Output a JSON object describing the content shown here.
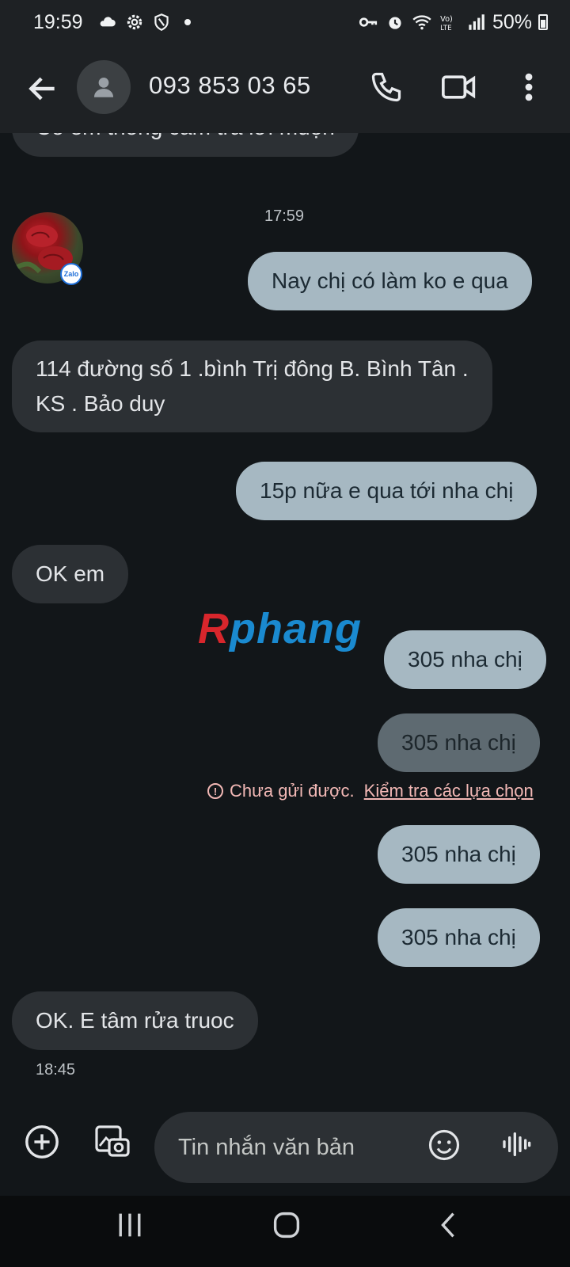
{
  "status_bar": {
    "time": "19:59",
    "battery": "50%",
    "network": "LTE"
  },
  "header": {
    "contact": "093 853 03 65"
  },
  "messages": [
    {
      "dir": "in",
      "text": "Cô em thông cảm trả lời muộn"
    },
    {
      "type": "time",
      "text": "17:59"
    },
    {
      "dir": "out",
      "text": "Nay chị có làm ko e qua"
    },
    {
      "dir": "in",
      "lines": [
        "114 đường  số 1 .bình Trị đông B. Bình Tân .",
        "KS . Bảo duy"
      ]
    },
    {
      "dir": "out",
      "text": "15p nữa e qua tới nha chị"
    },
    {
      "dir": "in",
      "text": "OK em"
    },
    {
      "dir": "out",
      "text": "305 nha chị"
    },
    {
      "dir": "out",
      "status": "failed",
      "text": "305 nha chị"
    },
    {
      "dir": "out",
      "text": "305 nha chị"
    },
    {
      "dir": "out",
      "text": "305 nha chị"
    },
    {
      "dir": "in",
      "text": "OK. E tâm rửa truoc"
    },
    {
      "type": "time",
      "text": "18:45"
    }
  ],
  "error": {
    "message": "Chưa gửi được.",
    "action": "Kiểm tra các lựa chọn"
  },
  "watermark": {
    "first": "R",
    "rest": "phang"
  },
  "composer": {
    "placeholder": "Tin nhắn văn bản"
  },
  "sender_badge": "Zalo",
  "colors": {
    "background": "#121619",
    "incoming_bubble": "#2c3034",
    "outgoing_bubble": "#a6b8c2",
    "failed_bubble": "#5e6a71",
    "error_text": "#f2b8b5"
  }
}
